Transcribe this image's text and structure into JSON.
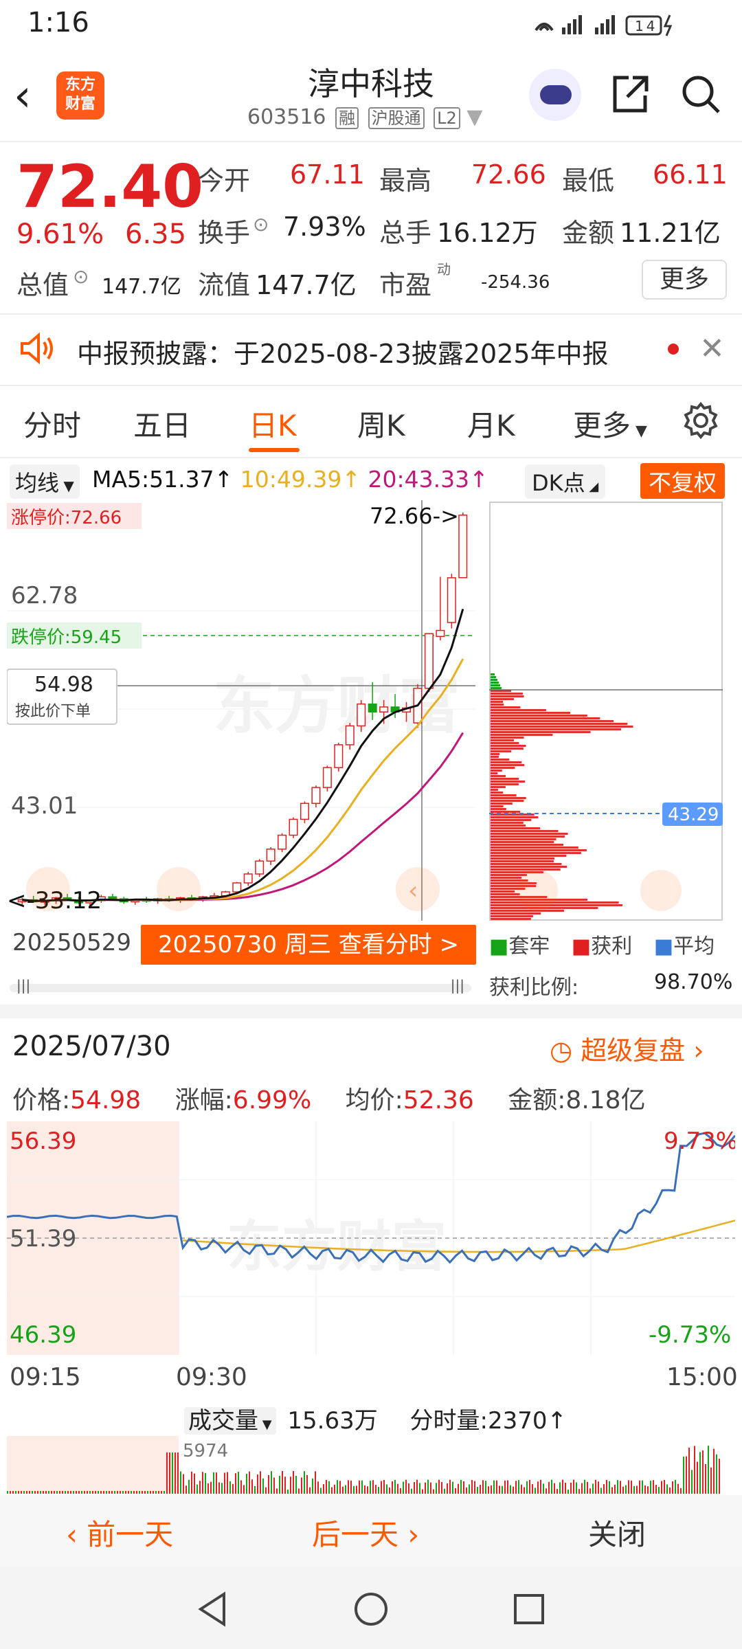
{
  "status_bar": {
    "time": "1:16",
    "icons_text": "4G 4G",
    "battery": "14"
  },
  "header": {
    "stock_name": "淳中科技",
    "stock_code": "603516",
    "tags": [
      "融",
      "沪股通",
      "L2"
    ],
    "logo_line1": "东方",
    "logo_line2": "财富"
  },
  "quote": {
    "price": "72.40",
    "change_pct": "9.61%",
    "change": "6.35",
    "open_label": "今开",
    "open": "67.11",
    "high_label": "最高",
    "high": "72.66",
    "low_label": "最低",
    "low": "66.11",
    "turnover_label": "换手",
    "turnover": "7.93%",
    "volume_label": "总手",
    "volume": "16.12万",
    "amount_label": "金额",
    "amount": "11.21亿",
    "mktcap_label": "总值",
    "mktcap": "147.7亿",
    "float_label": "流值",
    "float": "147.7亿",
    "pe_label": "市盈",
    "pe_sup": "动",
    "pe": "-254.36",
    "more_label": "更多"
  },
  "notice": {
    "text": "中报预披露：于2025-08-23披露2025年中报"
  },
  "tabs": [
    "分时",
    "五日",
    "日K",
    "周K",
    "月K",
    "更多"
  ],
  "ma_row": {
    "select_label": "均线",
    "ma5": "MA5:51.37↑",
    "ma10": "10:49.39↑",
    "ma20": "20:43.33↑",
    "dk_label": "DK点",
    "fq_label": "不复权"
  },
  "kline": {
    "limit_up_label": "涨停价:72.66",
    "limit_down_label": "跌停价:59.45",
    "price_marker": "72.66->",
    "y_labels": [
      "62.78",
      "43.01",
      "33.12"
    ],
    "crosshair_price": "54.98",
    "crosshair_hint": "按此价下单",
    "min_label": "<-33.12",
    "date_left": "20250529",
    "date_button": "20250730 周三 查看分时 >",
    "chip_price_label": "43.29",
    "chip_legend": [
      "套牢",
      "获利",
      "平均"
    ],
    "chip_ratio_label": "获利比例:",
    "chip_ratio_value": "98.70%"
  },
  "chart_data": {
    "type": "candlestick",
    "ylim": [
      33.12,
      72.66
    ],
    "candles": [
      [
        33.5,
        33.9,
        33.2,
        33.7
      ],
      [
        33.7,
        34.1,
        33.4,
        33.5
      ],
      [
        33.5,
        33.8,
        33.2,
        33.6
      ],
      [
        33.6,
        34.0,
        33.3,
        33.9
      ],
      [
        33.9,
        34.3,
        33.6,
        33.7
      ],
      [
        33.7,
        34.0,
        33.3,
        33.4
      ],
      [
        33.4,
        33.7,
        33.1,
        33.6
      ],
      [
        33.6,
        34.2,
        33.4,
        34.0
      ],
      [
        34.0,
        34.3,
        33.6,
        33.8
      ],
      [
        33.8,
        34.0,
        33.3,
        33.5
      ],
      [
        33.5,
        33.8,
        33.2,
        33.7
      ],
      [
        33.7,
        34.0,
        33.4,
        33.6
      ],
      [
        33.6,
        33.9,
        33.3,
        33.8
      ],
      [
        33.8,
        34.1,
        33.5,
        33.7
      ],
      [
        33.7,
        34.0,
        33.4,
        33.9
      ],
      [
        33.9,
        34.2,
        33.6,
        33.8
      ],
      [
        33.8,
        34.1,
        33.5,
        34.0
      ],
      [
        34.0,
        34.4,
        33.8,
        34.1
      ],
      [
        34.1,
        34.6,
        33.9,
        34.5
      ],
      [
        34.5,
        35.5,
        34.3,
        35.4
      ],
      [
        35.4,
        36.5,
        35.1,
        36.3
      ],
      [
        36.3,
        37.8,
        36.0,
        37.6
      ],
      [
        37.6,
        39.0,
        37.2,
        38.8
      ],
      [
        38.8,
        40.4,
        38.5,
        40.2
      ],
      [
        40.2,
        42.0,
        39.9,
        41.8
      ],
      [
        41.8,
        43.6,
        41.4,
        43.4
      ],
      [
        43.4,
        45.2,
        43.0,
        45.0
      ],
      [
        45.0,
        47.2,
        44.6,
        47.0
      ],
      [
        47.0,
        49.5,
        46.6,
        49.3
      ],
      [
        49.3,
        51.5,
        48.8,
        51.2
      ],
      [
        51.2,
        53.8,
        50.6,
        53.4
      ],
      [
        53.4,
        55.6,
        51.8,
        52.6
      ],
      [
        52.6,
        53.8,
        51.4,
        53.1
      ],
      [
        53.1,
        54.4,
        52.0,
        52.6
      ],
      [
        52.6,
        53.6,
        51.6,
        53.0
      ],
      [
        51.5,
        55.4,
        51.0,
        54.98
      ],
      [
        54.98,
        60.48,
        54.6,
        60.48
      ],
      [
        60.2,
        66.2,
        59.8,
        60.8
      ],
      [
        61.6,
        66.5,
        61.0,
        66.1
      ],
      [
        66.11,
        72.66,
        66.11,
        72.4
      ]
    ],
    "ma5_last": 51.37,
    "ma10_last": 49.39,
    "ma20_last": 43.33,
    "intraday": {
      "date": "2025/07/30",
      "ylim": [
        46.39,
        56.39
      ],
      "prev_close": 51.39,
      "y_labels_left": [
        "56.39",
        "51.39",
        "46.39"
      ],
      "y_labels_right": [
        "9.73%",
        "-9.73%"
      ],
      "time_labels": [
        "09:15",
        "09:30",
        "15:00"
      ]
    }
  },
  "intraday_stats": {
    "date_title": "2025/07/30",
    "replay_label": "超级复盘",
    "price_label": "价格:",
    "price": "54.98",
    "pct_label": "涨幅:",
    "pct": "6.99%",
    "avg_label": "均价:",
    "avg": "52.36",
    "amount_label": "金额:",
    "amount": "8.18亿"
  },
  "volume_row": {
    "select_label": "成交量",
    "total": "15.63万",
    "tick_label": "分时量:",
    "tick_value": "2370↑",
    "max_label": "5974"
  },
  "bottom": {
    "prev": "前一天",
    "next": "后一天",
    "close": "关闭"
  },
  "colors": {
    "up": "#e02020",
    "down": "#17a317",
    "accent": "#ff5a00",
    "ma5": "#111111",
    "ma10": "#e8b020",
    "ma20": "#c0187a"
  }
}
